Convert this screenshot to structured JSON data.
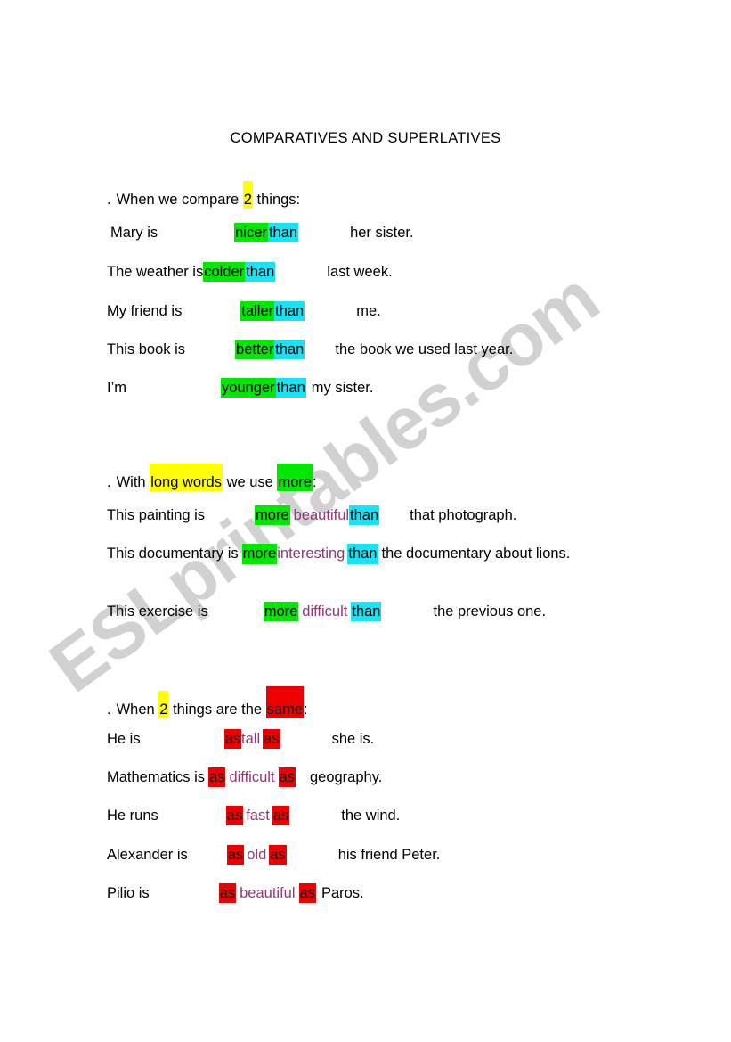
{
  "document": {
    "title": "COMPARATIVES AND SUPERLATIVES",
    "watermark": "ESLprintables.com"
  },
  "colors": {
    "green": "#00e800",
    "cyan": "#1ae2f5",
    "yellow": "#ffff00",
    "red": "#ee0000",
    "purple_text": "#8c3a78",
    "watermark_gray": "#cfcfcf",
    "page_background": "#ffffff",
    "text": "#000000"
  },
  "sections": [
    {
      "id": "comparatives",
      "heading": {
        "bullet": ".",
        "before": "When we compare",
        "highlight": "2",
        "after": "things:"
      },
      "examples": [
        {
          "subject": "Mary is",
          "adjective": "nicer",
          "comparator": "than",
          "object": "her sister."
        },
        {
          "subject": "The weather is",
          "adjective": "colder",
          "comparator": "than",
          "object": "last week."
        },
        {
          "subject": "My friend is",
          "adjective": "taller",
          "comparator": "than",
          "object": "me."
        },
        {
          "subject": "This book is",
          "adjective": "better",
          "comparator": "than",
          "object": "the book we used last year."
        },
        {
          "subject": "I’m",
          "adjective": "younger",
          "comparator": "than",
          "object": "my sister."
        }
      ]
    },
    {
      "id": "more-comparatives",
      "heading": {
        "bullet": ".",
        "before": "With",
        "highlight_yellow": "long words",
        "middle": "we use",
        "highlight_green": "more",
        "after": ":"
      },
      "examples": [
        {
          "subject": "This painting is",
          "more": "more",
          "adjective": "beautiful",
          "comparator": "than",
          "object": "that photograph."
        },
        {
          "subject": "This documentary is",
          "more": "more",
          "adjective": "interesting",
          "comparator": "than",
          "object": "the documentary about lions."
        },
        {
          "subject": "This exercise is",
          "more": "more",
          "adjective": "difficult",
          "comparator": "than",
          "object": "the previous one."
        }
      ]
    },
    {
      "id": "equatives",
      "heading": {
        "bullet": ".",
        "before": "When",
        "highlight_number": "2",
        "middle": "things are the",
        "highlight_red": "same",
        "after": ":"
      },
      "examples": [
        {
          "subject": "He is",
          "as1": "as",
          "adjective": "tall",
          "as2": "as",
          "object": "she is."
        },
        {
          "subject": "Mathematics is",
          "as1": "as",
          "adjective": "difficult",
          "as2": "as",
          "object": "geography."
        },
        {
          "subject": "He runs",
          "as1": "as",
          "adjective": "fast",
          "as2": "as",
          "object": "the wind."
        },
        {
          "subject": "Alexander is",
          "as1": "as",
          "adjective": "old",
          "as2": "as",
          "object": "his friend Peter."
        },
        {
          "subject": "Pilio is",
          "as1": "as",
          "adjective": "beautiful",
          "as2": "as",
          "object": "Paros."
        }
      ]
    }
  ]
}
